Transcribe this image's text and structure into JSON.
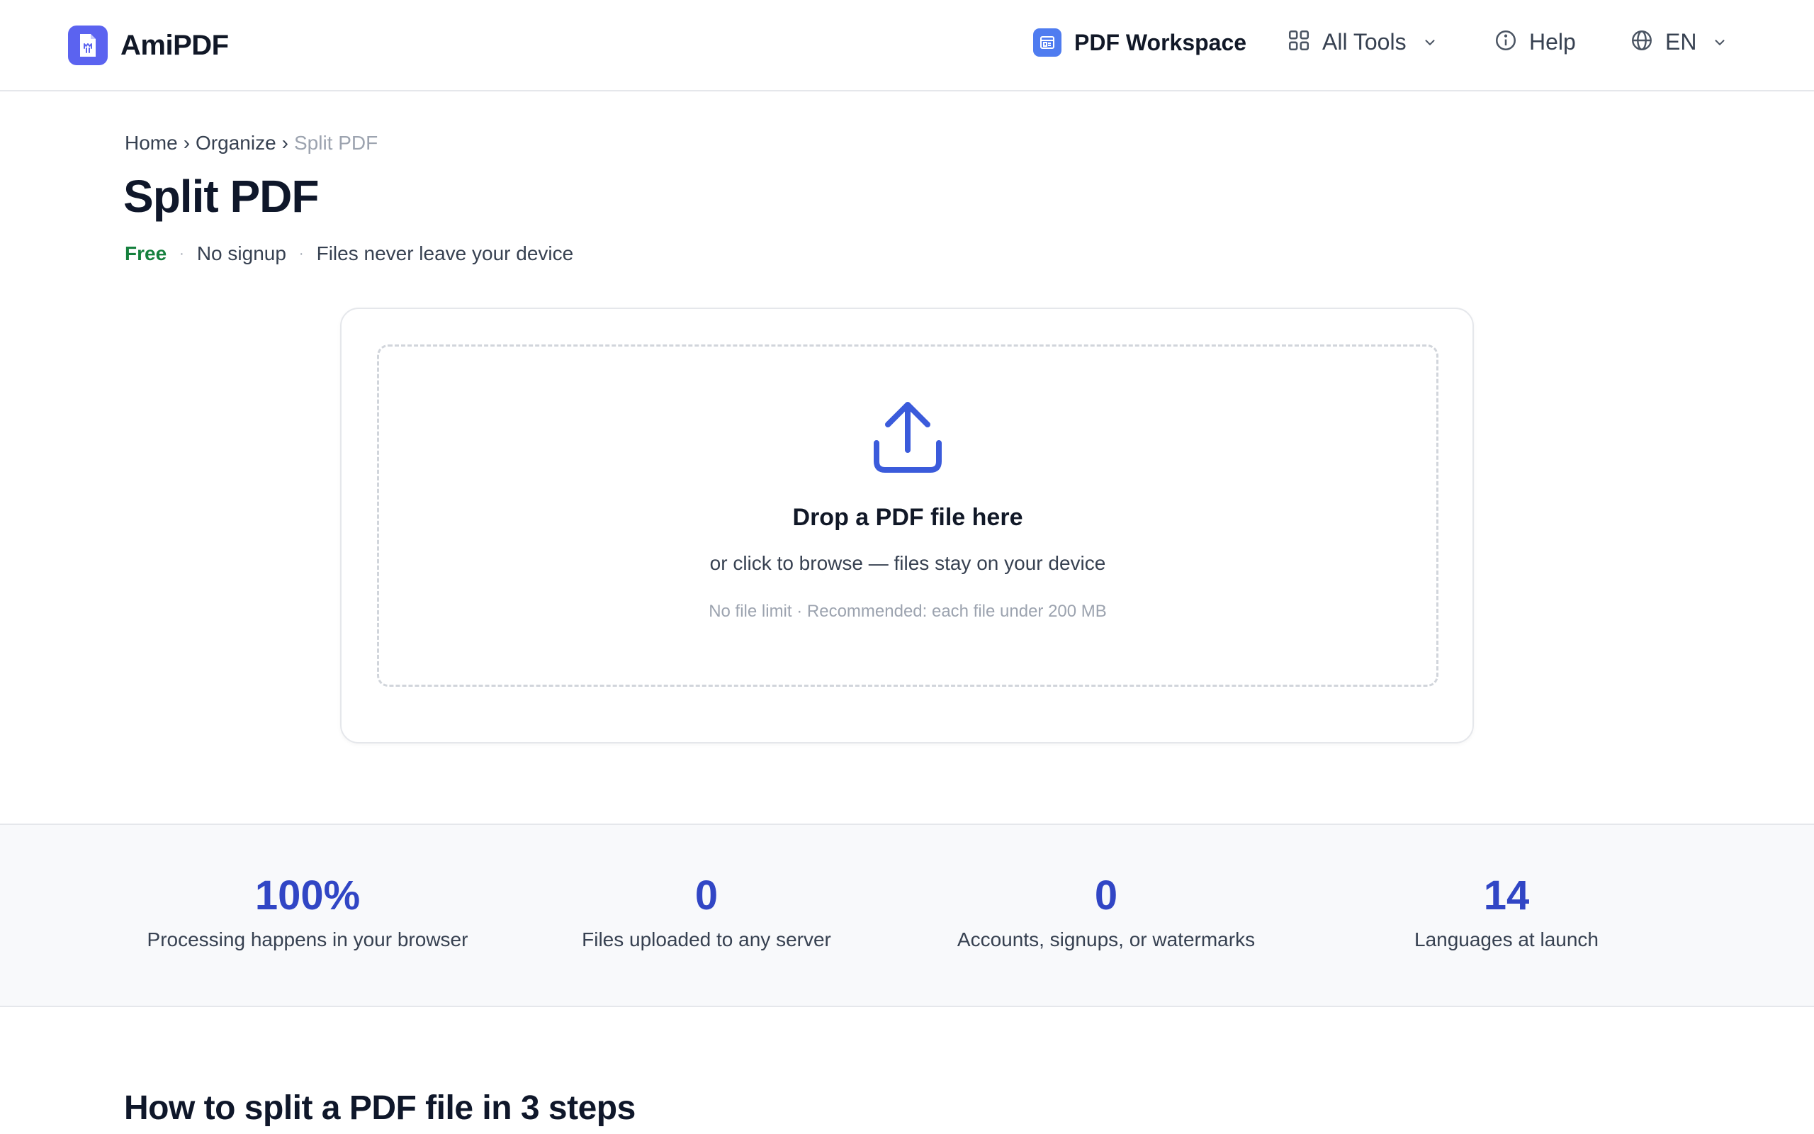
{
  "header": {
    "brand": "AmiPDF",
    "nav": {
      "workspace": "PDF Workspace",
      "tools": "All Tools",
      "help": "Help",
      "language": "EN"
    }
  },
  "breadcrumb": [
    "Home",
    "Organize",
    "Split PDF"
  ],
  "breadcrumb_separator": "›",
  "title": "Split PDF",
  "tagline": {
    "free": "Free",
    "separator": "·",
    "no_signup": "No signup",
    "privacy": "Files never leave your device"
  },
  "upload": {
    "title": "Drop a PDF file here",
    "subtitle": "or click to browse — files stay on your device",
    "hint": "No file limit · Recommended: each file under 200 MB",
    "icon": "upload-icon"
  },
  "stats": [
    {
      "value": "100%",
      "label": "Processing happens in your browser"
    },
    {
      "value": "0",
      "label": "Files uploaded to any server"
    },
    {
      "value": "0",
      "label": "Accounts, signups, or watermarks"
    },
    {
      "value": "14",
      "label": "Languages at launch"
    }
  ],
  "steps_title": "How to split a PDF file in 3 steps",
  "colors": {
    "brand": "#5b63f0",
    "accent": "#3146c5",
    "upload_icon": "#3b5bdb",
    "free_green": "#15803d"
  }
}
